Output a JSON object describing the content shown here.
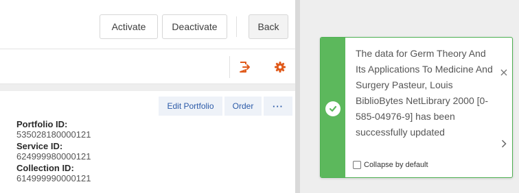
{
  "toolbar": {
    "activate_label": "Activate",
    "deactivate_label": "Deactivate",
    "back_label": "Back"
  },
  "icons": {
    "export": "export-icon",
    "settings": "gear-icon",
    "toast_status": "check-circle-icon",
    "toast_close": "close-icon",
    "toast_expand": "chevron-right-icon"
  },
  "actions": {
    "edit_portfolio_label": "Edit Portfolio",
    "order_label": "Order",
    "more_label": "···"
  },
  "details": {
    "portfolio_id_label": "Portfolio ID:",
    "portfolio_id_value": "535028180000121",
    "service_id_label": "Service ID:",
    "service_id_value": "624999980000121",
    "collection_id_label": "Collection ID:",
    "collection_id_value": "614999990000121"
  },
  "toast": {
    "message": "The data for Germ Theory And Its Applications To Medicine And Surgery Pasteur, Louis BiblioBytes NetLibrary 2000 [0-585-04976-9] has been successfully updated",
    "close_glyph": "×",
    "collapse_label": "Collapse by default",
    "collapse_checked": false
  },
  "colors": {
    "accent_orange": "#e05a1b",
    "success_green": "#5cb85c",
    "link_blue": "#2b5aa8"
  }
}
